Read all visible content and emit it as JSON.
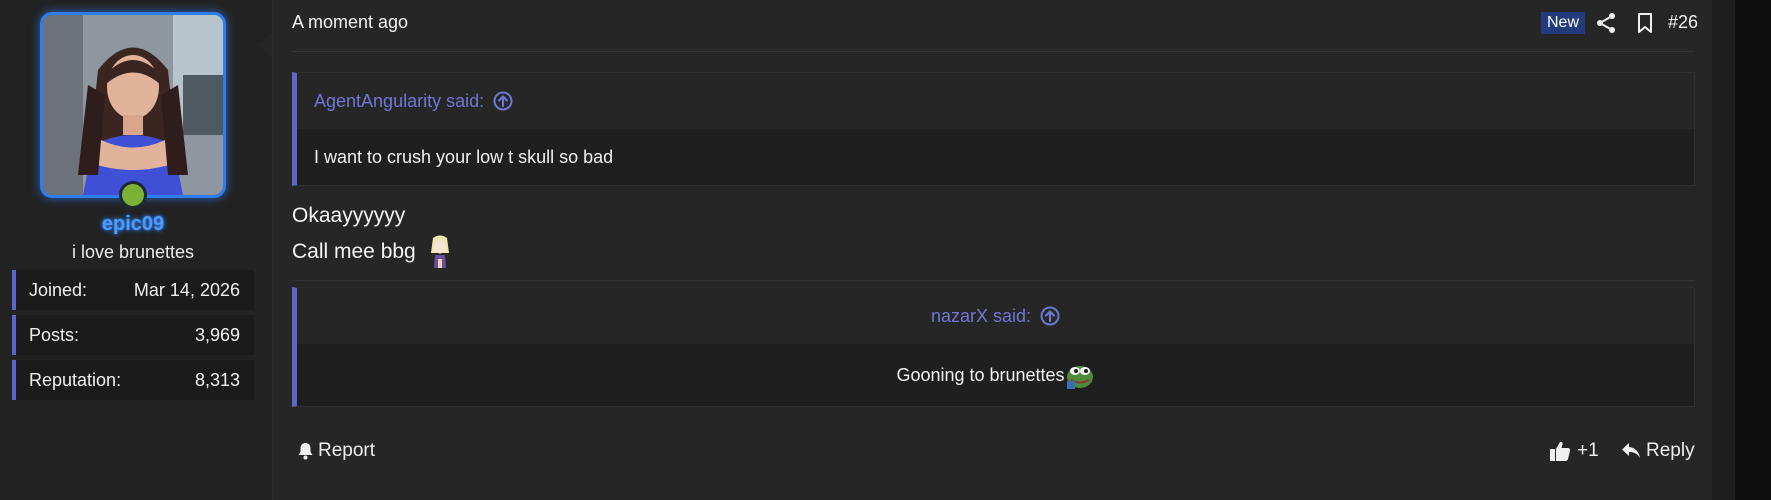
{
  "user": {
    "username": "epic09",
    "title": "i love brunettes",
    "online": true,
    "username_color": "#4d9bf5",
    "stats": [
      {
        "label": "Joined:",
        "value": "Mar 14, 2026"
      },
      {
        "label": "Posts:",
        "value": "3,969"
      },
      {
        "label": "Reputation:",
        "value": "8,313"
      }
    ]
  },
  "post": {
    "timestamp": "A moment ago",
    "badge": "New",
    "number": "#26",
    "quotes": [
      {
        "author_said": "AgentAngularity said:",
        "text": "I want to crush your low t skull so bad"
      },
      {
        "author_said": "nazarX said:",
        "text": "Gooning to brunettes"
      }
    ],
    "message_lines": [
      "Okaayyyyyy",
      "Call mee bbg"
    ],
    "footer": {
      "report_label": "Report",
      "like_label": "+1",
      "reply_label": "Reply"
    }
  },
  "icons": {
    "share": "share-icon",
    "bookmark": "bookmark-icon",
    "quote_jump": "arrow-up-circle-icon",
    "report": "bell-icon",
    "like": "thumbs-up-icon",
    "reply": "reply-arrow-icon"
  },
  "colors": {
    "accent": "#5b67c9",
    "quote_author": "#6d78d4",
    "badge_bg": "#233b7a",
    "online": "#7db036"
  }
}
